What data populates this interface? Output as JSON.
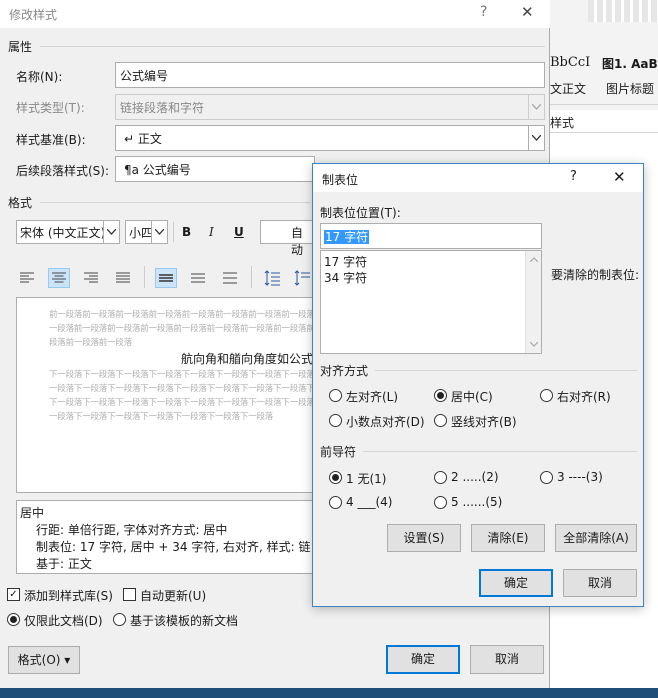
{
  "background": {
    "style_labels": [
      "BbCcI",
      "图1. AaB",
      "文正文",
      "图片标题"
    ],
    "pane_label": "样式"
  },
  "main_dialog": {
    "title": "修改样式",
    "help": "?",
    "close": "✕",
    "section_props": "属性",
    "name_label": "名称(N):",
    "name_value": "公式编号",
    "style_type_label": "样式类型(T):",
    "style_type_value": "链接段落和字符",
    "based_on_label": "样式基准(B):",
    "based_on_value": "↵ 正文",
    "next_style_label": "后续段落样式(S):",
    "next_style_value": "¶a 公式编号",
    "section_format": "格式",
    "font_value": "宋体 (中文正文)",
    "size_value": "小四",
    "bold": "B",
    "italic": "I",
    "underline": "U",
    "auto_color": "自动",
    "preview_prev": "前一段落前一段落前一段落前一段落前一段落前一段落前一段落前一段落",
    "preview_prev2": "一段落前一段落前一段落前一段落前一段落前一段落前一段落前一段落前",
    "preview_prev3": "段落前一段落前一段落",
    "preview_main": "航向角和艏向角度如公式",
    "preview_next": "下一段落下一段落下一段落下一段落下一段落下一段落下一段落下一段落",
    "preview_next2": "一段落下一段落下一段落下一段落下一段落下一段落下一段落下一段落下",
    "preview_next3": "下一段落下一段落下一段落下一段落下一段落下一段落下一段落下一段落",
    "preview_next4": "一段落下一段落下一段落下一段落下一段落下一段落下一段落",
    "desc_line1": "居中",
    "desc_line2": "行距: 单倍行距, 字体对齐方式: 居中",
    "desc_line3": "制表位: 17 字符, 居中 + 34 字符, 右对齐, 样式: 链",
    "desc_line4": "基于: 正文",
    "add_to_gallery": "添加到样式库(S)",
    "auto_update": "自动更新(U)",
    "only_this_doc": "仅限此文档(D)",
    "new_docs_template": "基于该模板的新文档",
    "format_button": "格式(O) ▾",
    "ok": "确定",
    "cancel": "取消"
  },
  "tabs_dialog": {
    "title": "制表位",
    "help": "?",
    "close": "✕",
    "position_label": "制表位位置(T):",
    "position_value": "17 字符",
    "positions": [
      "17 字符",
      "34 字符"
    ],
    "to_clear_label": "要清除的制表位:",
    "alignment_label": "对齐方式",
    "align_left": "左对齐(L)",
    "align_center": "居中(C)",
    "align_right": "右对齐(R)",
    "align_decimal": "小数点对齐(D)",
    "align_bar": "竖线对齐(B)",
    "leader_label": "前导符",
    "leader_1": "1 无(1)",
    "leader_2": "2 .....(2)",
    "leader_3": "3 ----(3)",
    "leader_4": "4 ___(4)",
    "leader_5": "5 ......(5)",
    "set": "设置(S)",
    "clear": "清除(E)",
    "clear_all": "全部清除(A)",
    "ok": "确定",
    "cancel": "取消"
  }
}
